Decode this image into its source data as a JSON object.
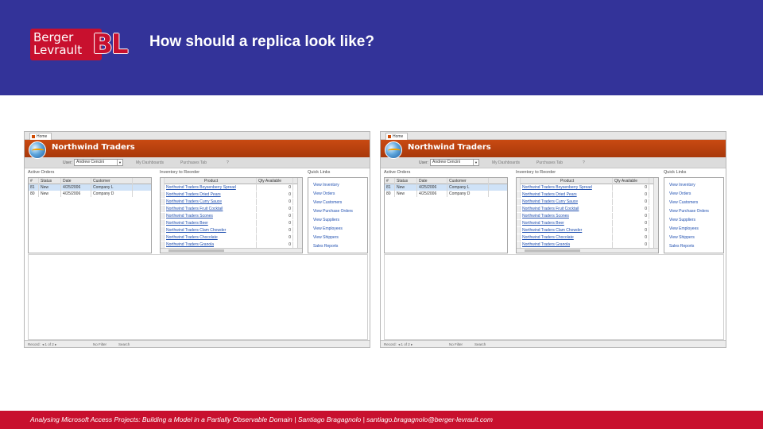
{
  "header": {
    "logo_line1": "Berger",
    "logo_line2": "Levrault",
    "logo_mark": "BL",
    "title": "How should a replica look like?"
  },
  "footer": {
    "text": "Analysing Microsoft Access Projects: Building a Model in a Partially Observable Domain | Santiago Bragagnolo | santiago.bragagnolo@berger-levrault.com"
  },
  "colors": {
    "header_bg": "#333399",
    "footer_bg": "#c8102e",
    "access_banner": "#b8420e",
    "link_blue": "#1f4fb0"
  },
  "access_app": {
    "tab_label": "Home",
    "banner_title": "Northwind Traders",
    "globe_icon": "northwind-globe-icon",
    "toolbar": {
      "user_label": "User:",
      "user_value": "Andrew Cencini",
      "link1": "My Dashboards",
      "link2": "Purchases Tab",
      "link3": "?"
    },
    "active_orders": {
      "title": "Active Orders",
      "columns": [
        "#",
        "Status",
        "Date",
        "Customer"
      ],
      "rows": [
        [
          "81",
          "New",
          "4/25/2006",
          "Company L"
        ],
        [
          "80",
          "New",
          "4/25/2006",
          "Company D"
        ]
      ]
    },
    "inventory": {
      "title": "Inventory to Reorder",
      "columns": [
        "Product",
        "Qty Available"
      ],
      "rows": [
        [
          "Northwind Traders Boysenberry Spread",
          "0"
        ],
        [
          "Northwind Traders Dried Pears",
          "0"
        ],
        [
          "Northwind Traders Curry Sauce",
          "0"
        ],
        [
          "Northwind Traders Fruit Cocktail",
          "0"
        ],
        [
          "Northwind Traders Scones",
          "0"
        ],
        [
          "Northwind Traders Beer",
          "0"
        ],
        [
          "Northwind Traders Clam Chowder",
          "0"
        ],
        [
          "Northwind Traders Chocolate",
          "0"
        ],
        [
          "Northwind Traders Granola",
          "0"
        ]
      ]
    },
    "quick_links": {
      "title": "Quick Links",
      "items": [
        "View Inventory",
        "View Orders",
        "View Customers",
        "View Purchase Orders",
        "View Suppliers",
        "View Employees",
        "View Shippers",
        "Sales Reports"
      ]
    },
    "statusbar": {
      "record_label": "Record:",
      "nav": "◂ 1 of 2 ▸",
      "filter": "No Filter",
      "search": "Search"
    }
  }
}
